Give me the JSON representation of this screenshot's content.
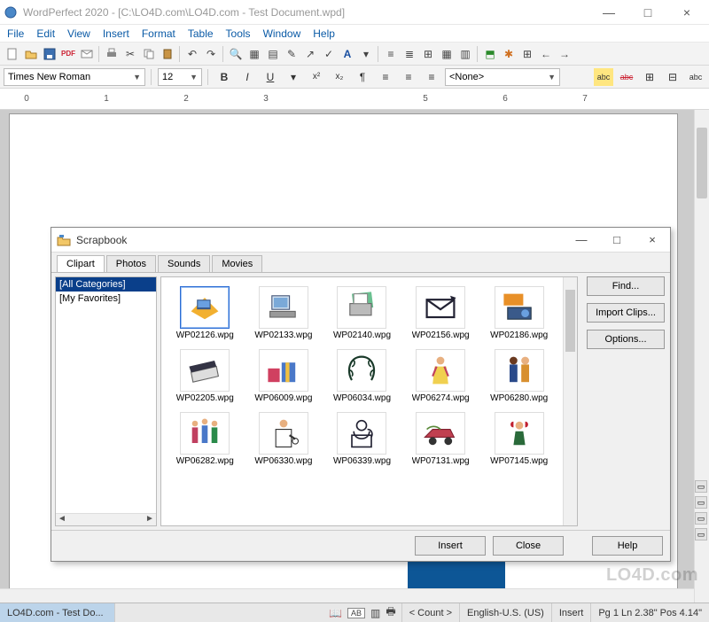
{
  "window": {
    "title": "WordPerfect 2020 - [C:\\LO4D.com\\LO4D.com - Test Document.wpd]",
    "min": "—",
    "max": "□",
    "close": "×"
  },
  "menu": [
    "File",
    "Edit",
    "View",
    "Insert",
    "Format",
    "Table",
    "Tools",
    "Window",
    "Help"
  ],
  "format": {
    "font": "Times New Roman",
    "size": "12",
    "style_combo": "<None>"
  },
  "ruler_marks": [
    "0",
    "1",
    "2",
    "3",
    "5",
    "6",
    "7"
  ],
  "status": {
    "doc": "LO4D.com - Test Do...",
    "btn_ab": "AB",
    "count": "< Count >",
    "lang": "English-U.S. (US)",
    "mode": "Insert",
    "pos": "Pg 1 Ln 2.38\" Pos 4.14\""
  },
  "watermark": "LO4D.com",
  "scrapbook": {
    "title": "Scrapbook",
    "win": {
      "min": "—",
      "max": "□",
      "close": "×"
    },
    "tabs": [
      "Clipart",
      "Photos",
      "Sounds",
      "Movies"
    ],
    "active_tab": 0,
    "categories": [
      "[All Categories]",
      "[My Favorites]"
    ],
    "selected_category": 0,
    "selected_clip": 0,
    "right_buttons": [
      "Find...",
      "Import Clips...",
      "Options..."
    ],
    "footer_buttons": [
      "Insert",
      "Close",
      "Help"
    ],
    "clips": [
      {
        "name": "WP02126.wpg",
        "icon": "laptop"
      },
      {
        "name": "WP02133.wpg",
        "icon": "desktop"
      },
      {
        "name": "WP02140.wpg",
        "icon": "printer"
      },
      {
        "name": "WP02156.wpg",
        "icon": "mail"
      },
      {
        "name": "WP02186.wpg",
        "icon": "projector"
      },
      {
        "name": "WP02205.wpg",
        "icon": "scanner"
      },
      {
        "name": "WP06009.wpg",
        "icon": "gifts"
      },
      {
        "name": "WP06034.wpg",
        "icon": "wreath"
      },
      {
        "name": "WP06274.wpg",
        "icon": "person1"
      },
      {
        "name": "WP06280.wpg",
        "icon": "couple"
      },
      {
        "name": "WP06282.wpg",
        "icon": "family"
      },
      {
        "name": "WP06330.wpg",
        "icon": "scientist"
      },
      {
        "name": "WP06339.wpg",
        "icon": "phone-woman"
      },
      {
        "name": "WP07131.wpg",
        "icon": "hotrod"
      },
      {
        "name": "WP07145.wpg",
        "icon": "bow-person"
      }
    ]
  }
}
